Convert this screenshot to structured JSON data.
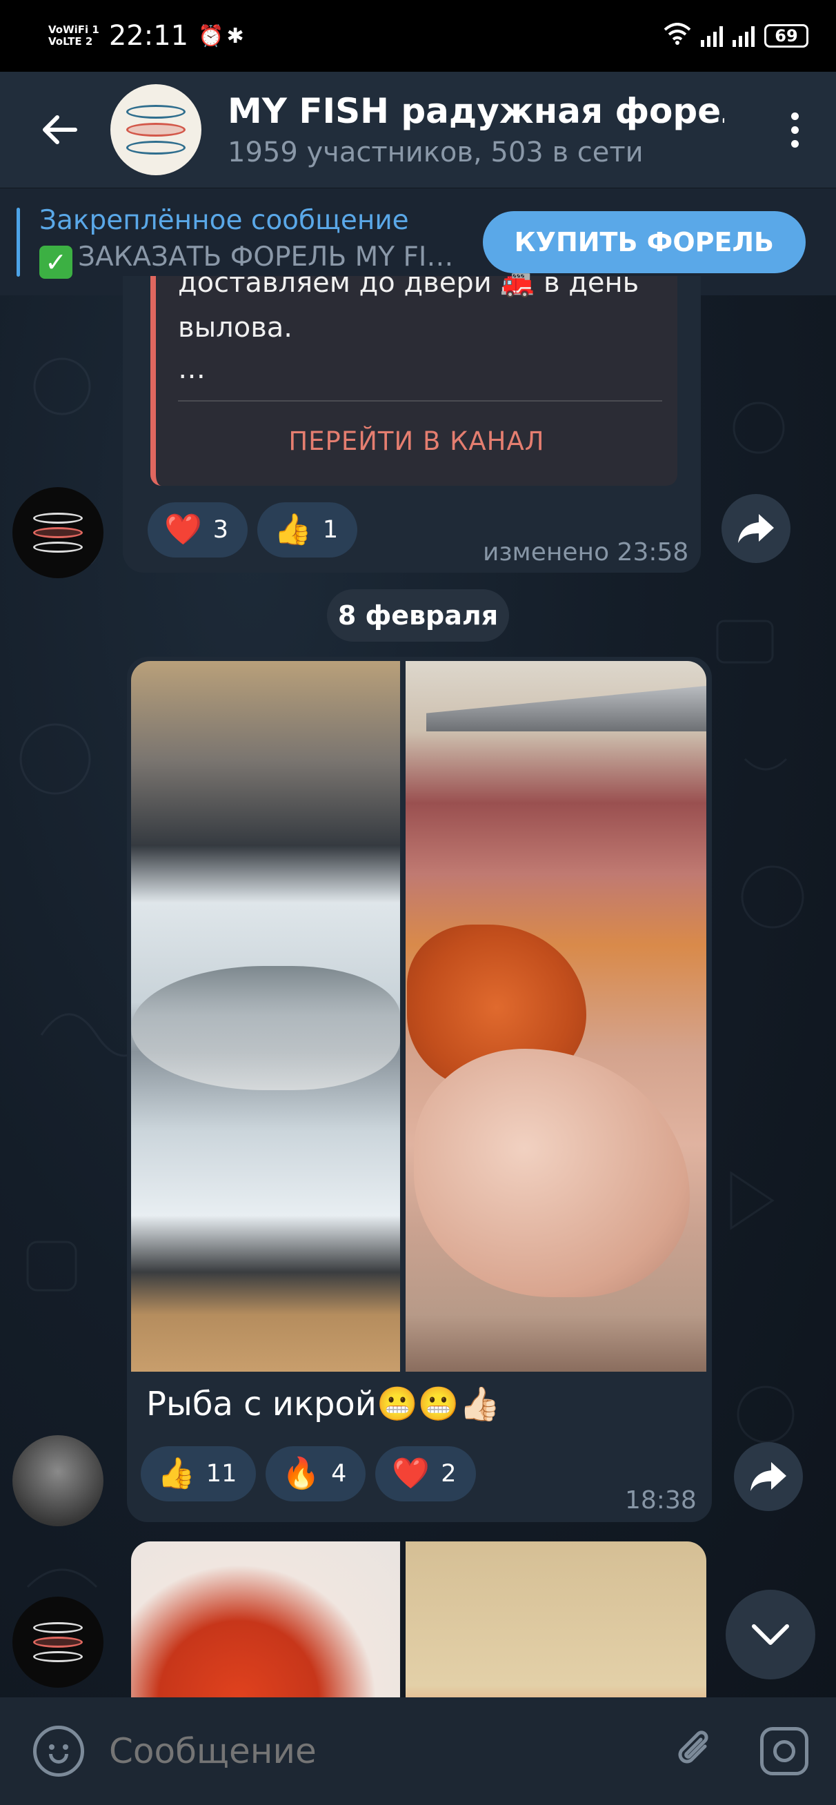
{
  "status_bar": {
    "network_top": "VoWiFi 1",
    "network_bottom": "VoLTE 2",
    "time": "22:11",
    "icons": [
      "alarm-icon",
      "bluetooth-icon"
    ],
    "battery": "69"
  },
  "header": {
    "title": "MY FISH радужная форел",
    "subtitle": "1959 участников, 503 в сети"
  },
  "pinned": {
    "title": "Закреплённое сообщение",
    "message": "ЗАКАЗАТЬ ФОРЕЛЬ MY FI…",
    "button": "КУПИТЬ ФОРЕЛЬ"
  },
  "message1": {
    "quote_line1": "доставляем до двери 🚒 в день",
    "quote_line2": "вылова.",
    "quote_line3": "…",
    "channel_button": "ПЕРЕЙТИ В КАНАЛ",
    "reactions": [
      {
        "emoji": "❤️",
        "count": "3"
      },
      {
        "emoji": "👍",
        "count": "1"
      }
    ],
    "time": "изменено 23:58"
  },
  "date_separator": "8 февраля",
  "message2": {
    "caption": "Рыба с икрой😬😬👍🏻",
    "reactions": [
      {
        "emoji": "👍",
        "count": "11"
      },
      {
        "emoji": "🔥",
        "count": "4"
      },
      {
        "emoji": "❤️",
        "count": "2"
      }
    ],
    "time": "18:38"
  },
  "input": {
    "placeholder": "Сообщение"
  },
  "colors": {
    "accent": "#5aa8e8",
    "header_bg": "#212d3b",
    "bubble_bg": "#1f2a37",
    "quote_accent": "#e0675f"
  }
}
